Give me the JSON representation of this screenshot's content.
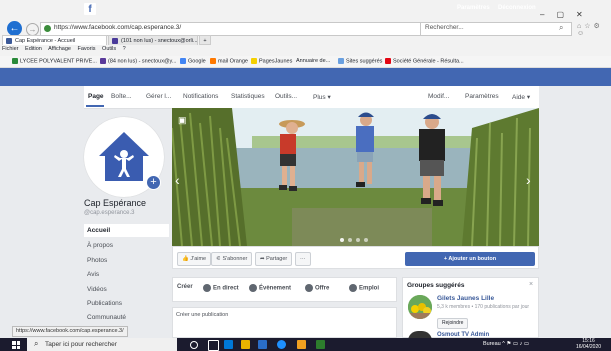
{
  "browser": {
    "url": "https://www.facebook.com/cap.esperance.3/",
    "search_placeholder": "Rechercher...",
    "tabs": [
      {
        "label": "Cap Espérance - Accueil"
      },
      {
        "label": "(101 non lus) - snectoux@orli..."
      }
    ],
    "new_tab": "+",
    "menu": [
      "Fichier",
      "Edition",
      "Affichage",
      "Favoris",
      "Outils",
      "?"
    ],
    "favorites": [
      "LYCEE POLYVALENT PRIVE...",
      "(84 non lus) - snectoux@y...",
      "Google",
      "mail Orange",
      "PagesJaunes",
      "Annuaire de...",
      "Sites suggérés",
      "Société Générale - Résulta..."
    ],
    "status_url": "https://www.facebook.com/cap.esperance.3/"
  },
  "fb_header": {
    "logo": "f",
    "params": "Paramètres",
    "logout": "Déconnexion"
  },
  "page_tabs": [
    "Page",
    "Boîte...",
    "Gérer l...",
    "Notifications",
    "Statistiques",
    "Outils...",
    "Plus ▾",
    "Modif...",
    "Paramètres",
    "Aide ▾"
  ],
  "page": {
    "name": "Cap Espérance",
    "handle": "@cap.esperance.3",
    "left_nav": [
      "Accueil",
      "À propos",
      "Photos",
      "Avis",
      "Vidéos",
      "Publications",
      "Communauté"
    ]
  },
  "actions": {
    "like": "J'aime",
    "follow": "S'abonner",
    "share": "Partager",
    "more": "···",
    "add_button": "+ Ajouter un bouton"
  },
  "create": {
    "label": "Créer",
    "live": "En direct",
    "event": "Évènement",
    "offer": "Offre",
    "job": "Emploi",
    "publication": "Créer une publication"
  },
  "groups": {
    "title": "Groupes suggérés",
    "close": "×",
    "g1_name": "Gilets Jaunes Lille",
    "g1_meta": "5,3 k membres • 170 publications par jour",
    "g1_join": "Rejoindre",
    "g2_name": "Osmout TV Admin"
  },
  "taskbar": {
    "search": "Taper ici pour rechercher",
    "right": "Bureau",
    "time": "15:16",
    "date": "16/04/2020"
  },
  "colors": {
    "fb_blue": "#4267b2",
    "taskbar": "#1b1b2e"
  }
}
